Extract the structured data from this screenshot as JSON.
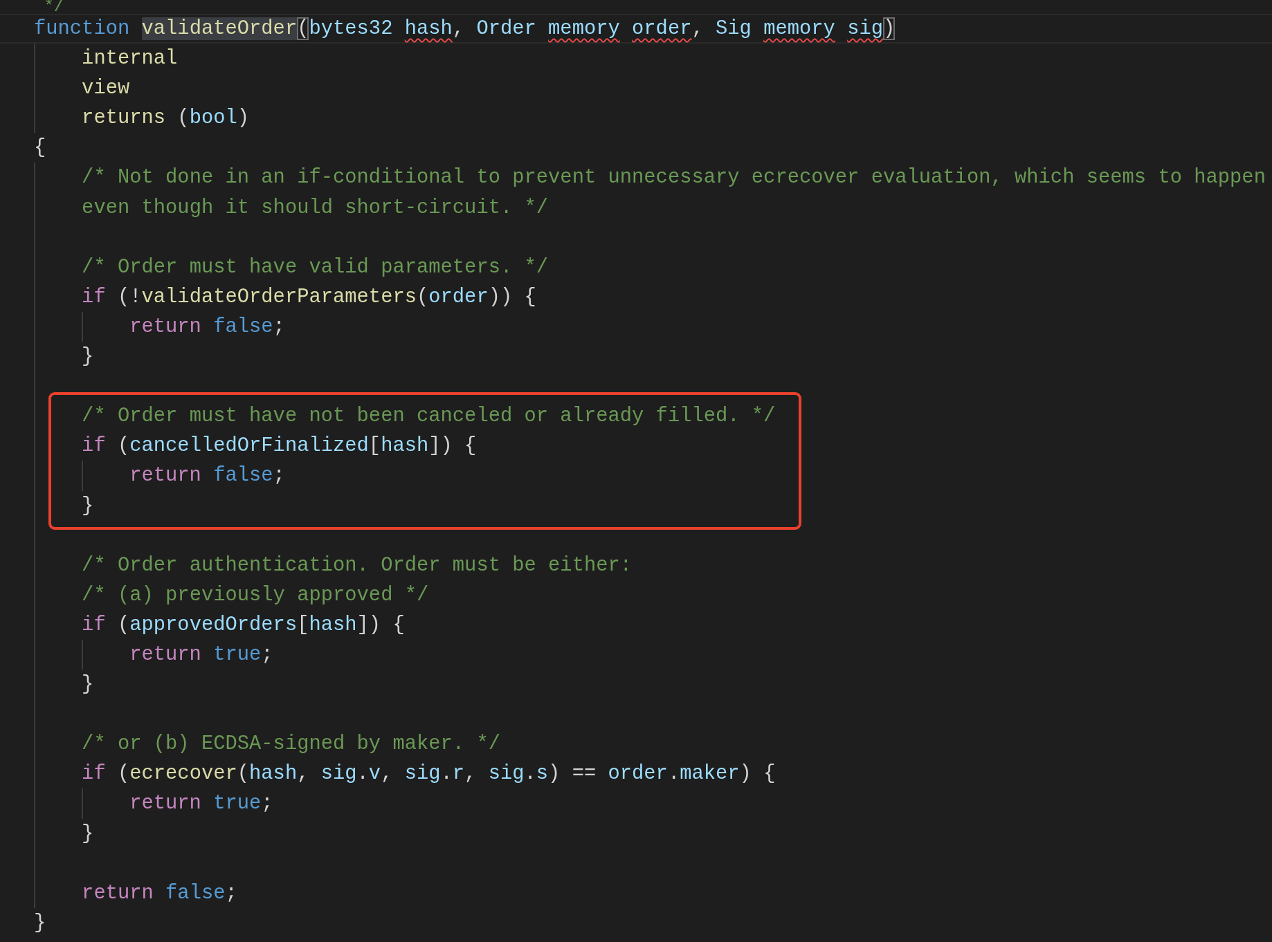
{
  "lines": [
    {
      "tokens": [
        {
          "text": " */",
          "kind": "cmt"
        }
      ],
      "current": false,
      "boxed": false
    },
    {
      "tokens": [
        {
          "text": "function ",
          "kind": "kw",
          "error": false,
          "hl": false
        },
        {
          "text": "validateOrder",
          "kind": "fn",
          "error": false,
          "hl": true
        },
        {
          "text": "(",
          "kind": "punct",
          "error": false,
          "hl": true
        },
        {
          "text": "bytes32 ",
          "kind": "var",
          "error": false,
          "hl": false
        },
        {
          "text": "hash",
          "kind": "var",
          "error": true,
          "hl": false
        },
        {
          "text": ", ",
          "kind": "punct",
          "error": false,
          "hl": false
        },
        {
          "text": "Order ",
          "kind": "var",
          "error": false,
          "hl": false
        },
        {
          "text": "memory ",
          "kind": "var",
          "error": true,
          "hl": false
        },
        {
          "text": "order",
          "kind": "var",
          "error": true,
          "hl": false
        },
        {
          "text": ", ",
          "kind": "punct",
          "error": false,
          "hl": false
        },
        {
          "text": "Sig ",
          "kind": "var",
          "error": false,
          "hl": false
        },
        {
          "text": "memory ",
          "kind": "var",
          "error": true,
          "hl": false
        },
        {
          "text": "sig",
          "kind": "var",
          "error": true,
          "hl": false
        },
        {
          "text": ")",
          "kind": "punct",
          "error": false,
          "hl": true
        }
      ],
      "current": true,
      "boxed": false
    },
    {
      "tokens": [
        {
          "text": "    internal",
          "kind": "fn"
        }
      ],
      "current": false,
      "boxed": false
    },
    {
      "tokens": [
        {
          "text": "    view",
          "kind": "fn"
        }
      ],
      "current": false,
      "boxed": false
    },
    {
      "tokens": [
        {
          "text": "    returns ",
          "kind": "fn"
        },
        {
          "text": "(",
          "kind": "punct"
        },
        {
          "text": "bool",
          "kind": "var"
        },
        {
          "text": ")",
          "kind": "punct"
        }
      ],
      "current": false,
      "boxed": false
    },
    {
      "tokens": [
        {
          "text": "{",
          "kind": "punct"
        }
      ],
      "current": false,
      "boxed": false
    },
    {
      "tokens": [
        {
          "text": "    /* Not done in an if-conditional to prevent unnecessary ecrecover evaluation, which seems to happen",
          "kind": "cmt"
        }
      ],
      "current": false,
      "boxed": false
    },
    {
      "tokens": [
        {
          "text": "    even though it should short-circuit. */",
          "kind": "cmt"
        }
      ],
      "current": false,
      "boxed": false
    },
    {
      "current": false,
      "boxed": false
    },
    {
      "tokens": [
        {
          "text": "    /* Order must have valid parameters. */",
          "kind": "cmt"
        }
      ],
      "current": false,
      "boxed": false
    },
    {
      "tokens": [
        {
          "text": "    if ",
          "kind": "ctrl"
        },
        {
          "text": "(!",
          "kind": "punct"
        },
        {
          "text": "validateOrderParameters",
          "kind": "fn"
        },
        {
          "text": "(",
          "kind": "punct"
        },
        {
          "text": "order",
          "kind": "var"
        },
        {
          "text": ")) {",
          "kind": "punct"
        }
      ],
      "current": false,
      "boxed": false
    },
    {
      "tokens": [
        {
          "text": "        return ",
          "kind": "ctrl"
        },
        {
          "text": "false",
          "kind": "kw"
        },
        {
          "text": ";",
          "kind": "punct"
        }
      ],
      "current": false,
      "boxed": false
    },
    {
      "tokens": [
        {
          "text": "    }",
          "kind": "punct"
        }
      ],
      "current": false,
      "boxed": false
    },
    {
      "current": false,
      "boxed": false
    },
    {
      "tokens": [
        {
          "text": "    /* Order must have not been canceled or already filled. */",
          "kind": "cmt"
        }
      ],
      "current": false,
      "boxed": true
    },
    {
      "tokens": [
        {
          "text": "    if ",
          "kind": "ctrl"
        },
        {
          "text": "(",
          "kind": "punct"
        },
        {
          "text": "cancelledOrFinalized",
          "kind": "var"
        },
        {
          "text": "[",
          "kind": "punct"
        },
        {
          "text": "hash",
          "kind": "var"
        },
        {
          "text": "]) {",
          "kind": "punct"
        }
      ],
      "current": false,
      "boxed": true
    },
    {
      "tokens": [
        {
          "text": "        return ",
          "kind": "ctrl"
        },
        {
          "text": "false",
          "kind": "kw"
        },
        {
          "text": ";",
          "kind": "punct"
        }
      ],
      "current": false,
      "boxed": true
    },
    {
      "tokens": [
        {
          "text": "    }",
          "kind": "punct"
        }
      ],
      "current": false,
      "boxed": true
    },
    {
      "current": false,
      "boxed": false
    },
    {
      "tokens": [
        {
          "text": "    /* Order authentication. Order must be either:",
          "kind": "cmt"
        }
      ],
      "current": false,
      "boxed": false
    },
    {
      "tokens": [
        {
          "text": "    /* (a) previously approved */",
          "kind": "cmt"
        }
      ],
      "current": false,
      "boxed": false
    },
    {
      "tokens": [
        {
          "text": "    if ",
          "kind": "ctrl"
        },
        {
          "text": "(",
          "kind": "punct"
        },
        {
          "text": "approvedOrders",
          "kind": "var"
        },
        {
          "text": "[",
          "kind": "punct"
        },
        {
          "text": "hash",
          "kind": "var"
        },
        {
          "text": "]) {",
          "kind": "punct"
        }
      ],
      "current": false,
      "boxed": false
    },
    {
      "tokens": [
        {
          "text": "        return ",
          "kind": "ctrl"
        },
        {
          "text": "true",
          "kind": "kw"
        },
        {
          "text": ";",
          "kind": "punct"
        }
      ],
      "current": false,
      "boxed": false
    },
    {
      "tokens": [
        {
          "text": "    }",
          "kind": "punct"
        }
      ],
      "current": false,
      "boxed": false
    },
    {
      "current": false,
      "boxed": false
    },
    {
      "tokens": [
        {
          "text": "    /* or (b) ECDSA-signed by maker. */",
          "kind": "cmt"
        }
      ],
      "current": false,
      "boxed": false
    },
    {
      "tokens": [
        {
          "text": "    if ",
          "kind": "ctrl"
        },
        {
          "text": "(",
          "kind": "punct"
        },
        {
          "text": "ecrecover",
          "kind": "fn"
        },
        {
          "text": "(",
          "kind": "punct"
        },
        {
          "text": "hash",
          "kind": "var"
        },
        {
          "text": ", ",
          "kind": "punct"
        },
        {
          "text": "sig",
          "kind": "var"
        },
        {
          "text": ".",
          "kind": "punct"
        },
        {
          "text": "v",
          "kind": "var"
        },
        {
          "text": ", ",
          "kind": "punct"
        },
        {
          "text": "sig",
          "kind": "var"
        },
        {
          "text": ".",
          "kind": "punct"
        },
        {
          "text": "r",
          "kind": "var"
        },
        {
          "text": ", ",
          "kind": "punct"
        },
        {
          "text": "sig",
          "kind": "var"
        },
        {
          "text": ".",
          "kind": "punct"
        },
        {
          "text": "s",
          "kind": "var"
        },
        {
          "text": ") == ",
          "kind": "punct"
        },
        {
          "text": "order",
          "kind": "var"
        },
        {
          "text": ".",
          "kind": "punct"
        },
        {
          "text": "maker",
          "kind": "var"
        },
        {
          "text": ") {",
          "kind": "punct"
        }
      ],
      "current": false,
      "boxed": false
    },
    {
      "tokens": [
        {
          "text": "        return ",
          "kind": "ctrl"
        },
        {
          "text": "true",
          "kind": "kw"
        },
        {
          "text": ";",
          "kind": "punct"
        }
      ],
      "current": false,
      "boxed": false
    },
    {
      "tokens": [
        {
          "text": "    }",
          "kind": "punct"
        }
      ],
      "current": false,
      "boxed": false
    },
    {
      "current": false,
      "boxed": false
    },
    {
      "tokens": [
        {
          "text": "    return ",
          "kind": "ctrl"
        },
        {
          "text": "false",
          "kind": "kw"
        },
        {
          "text": ";",
          "kind": "punct"
        }
      ],
      "current": false,
      "boxed": false
    },
    {
      "tokens": [
        {
          "text": "}",
          "kind": "punct"
        }
      ],
      "current": false,
      "boxed": false
    }
  ]
}
